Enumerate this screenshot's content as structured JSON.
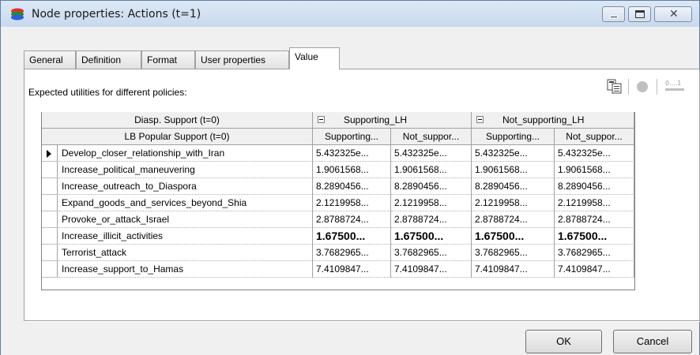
{
  "window": {
    "title": "Node properties: Actions (t=1)"
  },
  "tabs": [
    {
      "label": "General"
    },
    {
      "label": "Definition"
    },
    {
      "label": "Format"
    },
    {
      "label": "User properties"
    },
    {
      "label": "Value"
    }
  ],
  "panel": {
    "heading": "Expected utilities for different policies:"
  },
  "grid": {
    "header1": {
      "label": "Diasp. Support (t=0)",
      "groups": [
        "Supporting_LH",
        "Not_supporting_LH"
      ]
    },
    "header2": {
      "label": "LB Popular Support (t=0)",
      "columns": [
        "Supporting...",
        "Not_suppor...",
        "Supporting...",
        "Not_suppor..."
      ]
    },
    "rows": [
      {
        "label": "Develop_closer_relationship_with_Iran",
        "values": [
          "5.432325e...",
          "5.432325e...",
          "5.432325e...",
          "5.432325e..."
        ]
      },
      {
        "label": "Increase_political_maneuvering",
        "values": [
          "1.9061568...",
          "1.9061568...",
          "1.9061568...",
          "1.9061568..."
        ]
      },
      {
        "label": "Increase_outreach_to_Diaspora",
        "values": [
          "8.2890456...",
          "8.2890456...",
          "8.2890456...",
          "8.2890456..."
        ]
      },
      {
        "label": "Expand_goods_and_services_beyond_Shia",
        "values": [
          "2.1219958...",
          "2.1219958...",
          "2.1219958...",
          "2.1219958..."
        ]
      },
      {
        "label": "Provoke_or_attack_Israel",
        "values": [
          "2.8788724...",
          "2.8788724...",
          "2.8788724...",
          "2.8788724..."
        ]
      },
      {
        "label": "Increase_illicit_activities",
        "values": [
          "1.67500...",
          "1.67500...",
          "1.67500...",
          "1.67500..."
        ]
      },
      {
        "label": "Terrorist_attack",
        "values": [
          "3.7682965...",
          "3.7682965...",
          "3.7682965...",
          "3.7682965..."
        ]
      },
      {
        "label": "Increase_support_to_Hamas",
        "values": [
          "7.4109847...",
          "7.4109847...",
          "7.4109847...",
          "7.4109847..."
        ]
      }
    ],
    "bold_row_label": "Increase_illicit_activities"
  },
  "toolbar": {
    "copy_icon": "copy-icon",
    "record_icon": "circle-icon",
    "numbers_icon": "0..1",
    "numbers_label": "0....1"
  },
  "buttons": {
    "ok": "OK",
    "cancel": "Cancel"
  }
}
